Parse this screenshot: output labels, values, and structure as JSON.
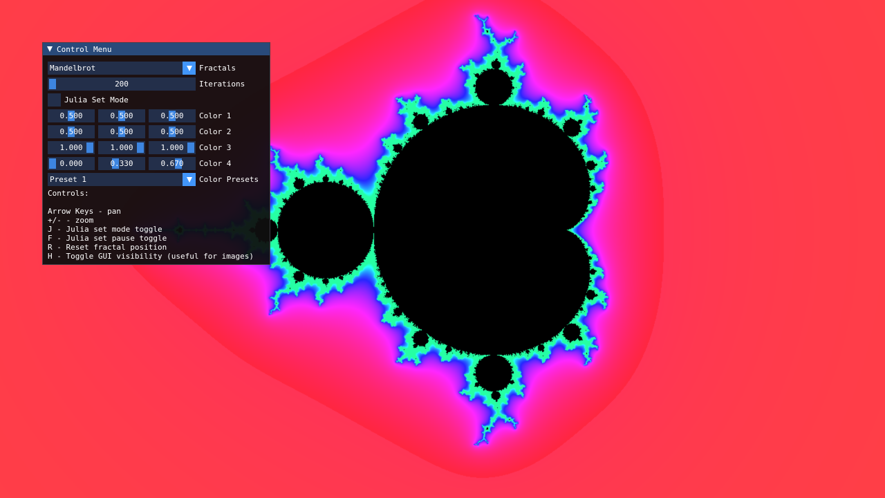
{
  "window": {
    "title": "Control Menu"
  },
  "fractal_select": {
    "value": "Mandelbrot",
    "label": "Fractals"
  },
  "iterations": {
    "value": "200",
    "label": "Iterations",
    "fraction": 0.0
  },
  "julia_mode": {
    "label": "Julia Set Mode",
    "checked": false
  },
  "colors": [
    {
      "label": "Color 1",
      "values": [
        "0.500",
        "0.500",
        "0.500"
      ],
      "fractions": [
        0.5,
        0.5,
        0.5
      ]
    },
    {
      "label": "Color 2",
      "values": [
        "0.500",
        "0.500",
        "0.500"
      ],
      "fractions": [
        0.5,
        0.5,
        0.5
      ]
    },
    {
      "label": "Color 3",
      "values": [
        "1.000",
        "1.000",
        "1.000"
      ],
      "fractions": [
        1.0,
        1.0,
        1.0
      ]
    },
    {
      "label": "Color 4",
      "values": [
        "0.000",
        "0.330",
        "0.670"
      ],
      "fractions": [
        0.0,
        0.33,
        0.67
      ]
    }
  ],
  "preset_select": {
    "value": "Preset 1",
    "label": "Color Presets"
  },
  "help": {
    "heading": "Controls:",
    "lines": [
      "Arrow Keys - pan",
      "+/- - zoom",
      "J - Julia set mode toggle",
      "F - Julia set pause toggle",
      "R - Reset fractal position",
      "H - Toggle GUI visibility (useful for images)"
    ]
  },
  "theme": {
    "title_bg": "#294a7a",
    "accent": "#4296fa",
    "grab": "#3d85e0"
  },
  "icons": {
    "collapse": "triangle-down-icon",
    "combo_arrow": "triangle-down-icon"
  }
}
